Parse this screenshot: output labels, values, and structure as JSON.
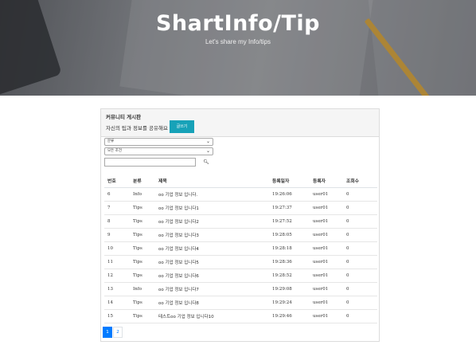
{
  "header": {
    "title": "ShartInfo/Tip",
    "subtitle": "Let's share my Info/tips"
  },
  "board": {
    "title": "커뮤니티 게시판",
    "description": "자신의 팁과 정보를 공유해요",
    "write_button": "글쓰기",
    "category_select": "분류",
    "sort_select": "모든 조건",
    "search_icon": "search-icon",
    "columns": [
      "번호",
      "분류",
      "제목",
      "등록일자",
      "등록자",
      "조회수"
    ],
    "rows": [
      {
        "no": "6",
        "category": "Info",
        "title": "oo 기업 정보 입니다.",
        "date": "19:26:06",
        "author": "user01",
        "views": "0"
      },
      {
        "no": "7",
        "category": "Tips",
        "title": "oo 기업 정보 입니다1",
        "date": "19:27:37",
        "author": "user01",
        "views": "0"
      },
      {
        "no": "8",
        "category": "Tips",
        "title": "oo 기업 정보 입니다2",
        "date": "19:27:52",
        "author": "user01",
        "views": "0"
      },
      {
        "no": "9",
        "category": "Tips",
        "title": "oo 기업 정보 입니다3",
        "date": "19:28:05",
        "author": "user01",
        "views": "0"
      },
      {
        "no": "10",
        "category": "Tips",
        "title": "oo 기업 정보 입니다4",
        "date": "19:28:18",
        "author": "user01",
        "views": "0"
      },
      {
        "no": "11",
        "category": "Tips",
        "title": "oo 기업 정보 입니다5",
        "date": "19:28:36",
        "author": "user01",
        "views": "0"
      },
      {
        "no": "12",
        "category": "Tips",
        "title": "oo 기업 정보 입니다6",
        "date": "19:28:52",
        "author": "user01",
        "views": "0"
      },
      {
        "no": "13",
        "category": "Info",
        "title": "oo 기업 정보 입니다7",
        "date": "19:29:08",
        "author": "user01",
        "views": "0"
      },
      {
        "no": "14",
        "category": "Tips",
        "title": "oo 기업 정보 입니다8",
        "date": "19:29:24",
        "author": "user01",
        "views": "0"
      },
      {
        "no": "15",
        "category": "Tips",
        "title": "테스트oo 기업 정보 입니다10",
        "date": "19:29:46",
        "author": "user01",
        "views": "0"
      }
    ],
    "pages": [
      "1",
      "2"
    ],
    "active_page": "1"
  },
  "colors": {
    "accent_button": "#17a2b8",
    "pagination_active": "#007bff"
  }
}
